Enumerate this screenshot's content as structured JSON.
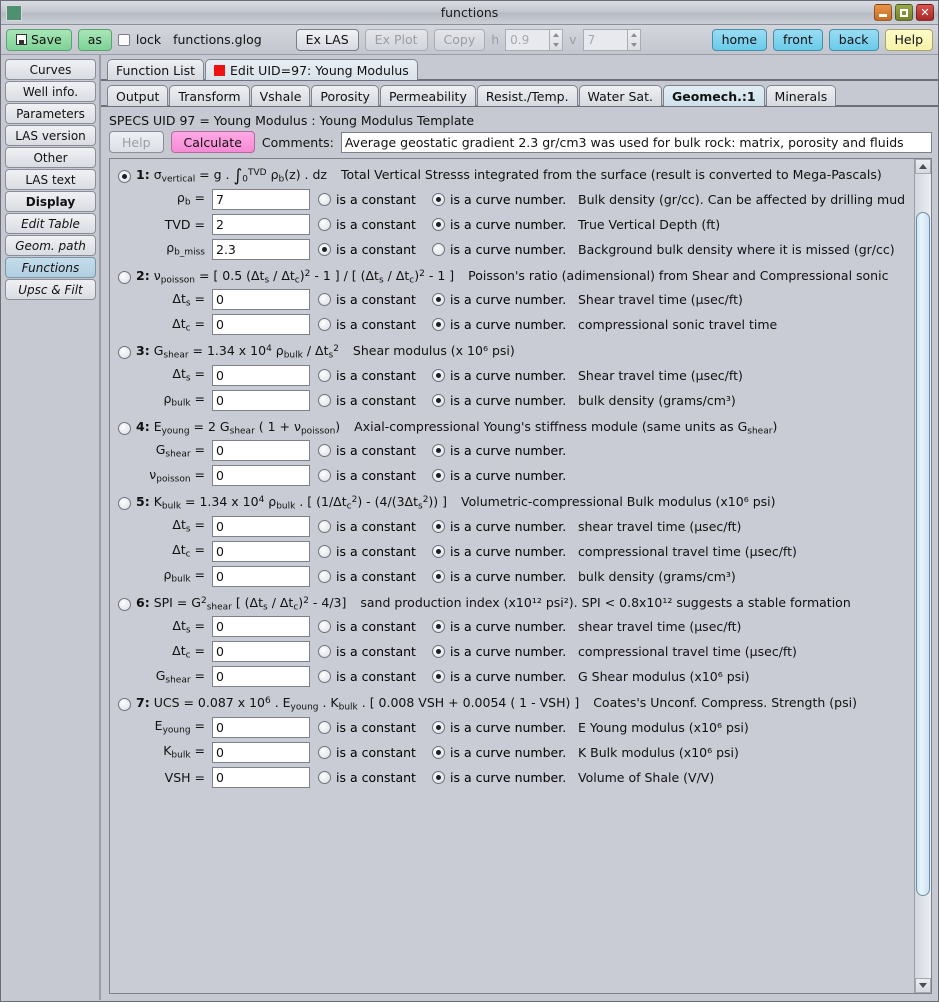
{
  "window": {
    "title": "functions",
    "buttons": {
      "minimize": "minimize-icon",
      "maximize": "maximize-icon",
      "close": "close-icon"
    }
  },
  "toolbar": {
    "save_label": "Save",
    "as_label": "as",
    "lock_label": "lock",
    "filename": "functions.glog",
    "ex_las_label": "Ex LAS",
    "ex_plot_label": "Ex Plot",
    "copy_label": "Copy",
    "h_label": "h",
    "h_value": "0.9",
    "v_label": "v",
    "v_value": "7",
    "home_label": "home",
    "front_label": "front",
    "back_label": "back",
    "help_label": "Help"
  },
  "sidebar": {
    "items": [
      {
        "label": "Curves",
        "style": "normal",
        "active": false
      },
      {
        "label": "Well info.",
        "style": "normal",
        "active": false
      },
      {
        "label": "Parameters",
        "style": "normal",
        "active": false
      },
      {
        "label": "LAS version",
        "style": "normal",
        "active": false
      },
      {
        "label": "Other",
        "style": "normal",
        "active": false
      },
      {
        "label": "LAS text",
        "style": "normal",
        "active": false
      },
      {
        "label": "Display",
        "style": "bold",
        "active": false
      },
      {
        "label": "Edit Table",
        "style": "italic",
        "active": false
      },
      {
        "label": "Geom. path",
        "style": "italic",
        "active": false
      },
      {
        "label": "Functions",
        "style": "italic",
        "active": true
      },
      {
        "label": "Upsc & Filt",
        "style": "italic",
        "active": false
      }
    ]
  },
  "main_tabs": [
    {
      "label": "Function List",
      "active": false,
      "indicator": false
    },
    {
      "label": "Edit UID=97: Young Modulus",
      "active": true,
      "indicator": true
    }
  ],
  "sub_tabs": [
    {
      "label": "Output",
      "active": false
    },
    {
      "label": "Transform",
      "active": false
    },
    {
      "label": "Vshale",
      "active": false
    },
    {
      "label": "Porosity",
      "active": false
    },
    {
      "label": "Permeability",
      "active": false
    },
    {
      "label": "Resist./Temp.",
      "active": false
    },
    {
      "label": "Water Sat.",
      "active": false
    },
    {
      "label": "Geomech.:1",
      "active": true
    },
    {
      "label": "Minerals",
      "active": false
    }
  ],
  "specs_line": "SPECS UID 97 = Young Modulus : Young Modulus Template",
  "controls": {
    "help_label": "Help",
    "calculate_label": "Calculate",
    "comments_label": "Comments:",
    "comments_value": "Average geostatic gradient 2.3 gr/cm3 was used for bulk rock: matrix, porosity and fluids"
  },
  "option_labels": {
    "constant": "is a constant",
    "curve": "is a curve number."
  },
  "formulas": [
    {
      "number": "1:",
      "selected": true,
      "description": "Total Vertical Stresss integrated from the surface (result is converted to Mega-Pascals)",
      "params": [
        {
          "value": "7",
          "mode": "curve",
          "desc": "Bulk density (gr/cc). Can be affected by drilling mud"
        },
        {
          "value": "2",
          "mode": "curve",
          "desc": "True Vertical Depth (ft)"
        },
        {
          "value": "2.3",
          "mode": "constant",
          "desc": "Background bulk density where it is missed (gr/cc)"
        }
      ]
    },
    {
      "number": "2:",
      "selected": false,
      "description": "Poisson's ratio (adimensional) from Shear and Compressional sonic",
      "params": [
        {
          "value": "0",
          "mode": "curve",
          "desc": "Shear travel time (μsec/ft)"
        },
        {
          "value": "0",
          "mode": "curve",
          "desc": "compressional sonic travel time"
        }
      ]
    },
    {
      "number": "3:",
      "selected": false,
      "description": "Shear modulus (x 10⁶ psi)",
      "params": [
        {
          "value": "0",
          "mode": "curve",
          "desc": "Shear travel time (μsec/ft)"
        },
        {
          "value": "0",
          "mode": "curve",
          "desc": "bulk density (grams/cm³)"
        }
      ]
    },
    {
      "number": "4:",
      "selected": false,
      "description": "Axial-compressional Young's stiffness module (same units as G shear)",
      "params": [
        {
          "value": "0",
          "mode": "curve",
          "desc": ""
        },
        {
          "value": "0",
          "mode": "curve",
          "desc": ""
        }
      ]
    },
    {
      "number": "5:",
      "selected": false,
      "description": "Volumetric-compressional Bulk modulus (x10⁶ psi)",
      "params": [
        {
          "value": "0",
          "mode": "curve",
          "desc": "shear travel time (μsec/ft)"
        },
        {
          "value": "0",
          "mode": "curve",
          "desc": "compressional travel time (μsec/ft)"
        },
        {
          "value": "0",
          "mode": "curve",
          "desc": "bulk density (grams/cm³)"
        }
      ]
    },
    {
      "number": "6:",
      "selected": false,
      "description": "sand production index (x10¹² psi²). SPI < 0.8x10¹² suggests a stable formation",
      "params": [
        {
          "value": "0",
          "mode": "curve",
          "desc": "shear travel time (μsec/ft)"
        },
        {
          "value": "0",
          "mode": "curve",
          "desc": "compressional travel time (μsec/ft)"
        },
        {
          "value": "0",
          "mode": "curve",
          "desc": "G Shear modulus (x10⁶ psi)"
        }
      ]
    },
    {
      "number": "7:",
      "selected": false,
      "description": "Coates's Unconf. Compress. Strength (psi)",
      "params": [
        {
          "value": "0",
          "mode": "curve",
          "desc": "E Young modulus (x10⁶ psi)"
        },
        {
          "value": "0",
          "mode": "curve",
          "desc": "K Bulk modulus (x10⁶ psi)"
        },
        {
          "value": "0",
          "mode": "curve",
          "desc": "Volume of Shale (V/V)"
        }
      ]
    }
  ],
  "colors": {
    "accent_green": "#7fd397",
    "accent_blue": "#69cbea",
    "accent_pink": "#f78ad6",
    "accent_yellow": "#f7f2a8",
    "tab_active": "#cfe1ec",
    "indicator_red": "#ee1111"
  }
}
